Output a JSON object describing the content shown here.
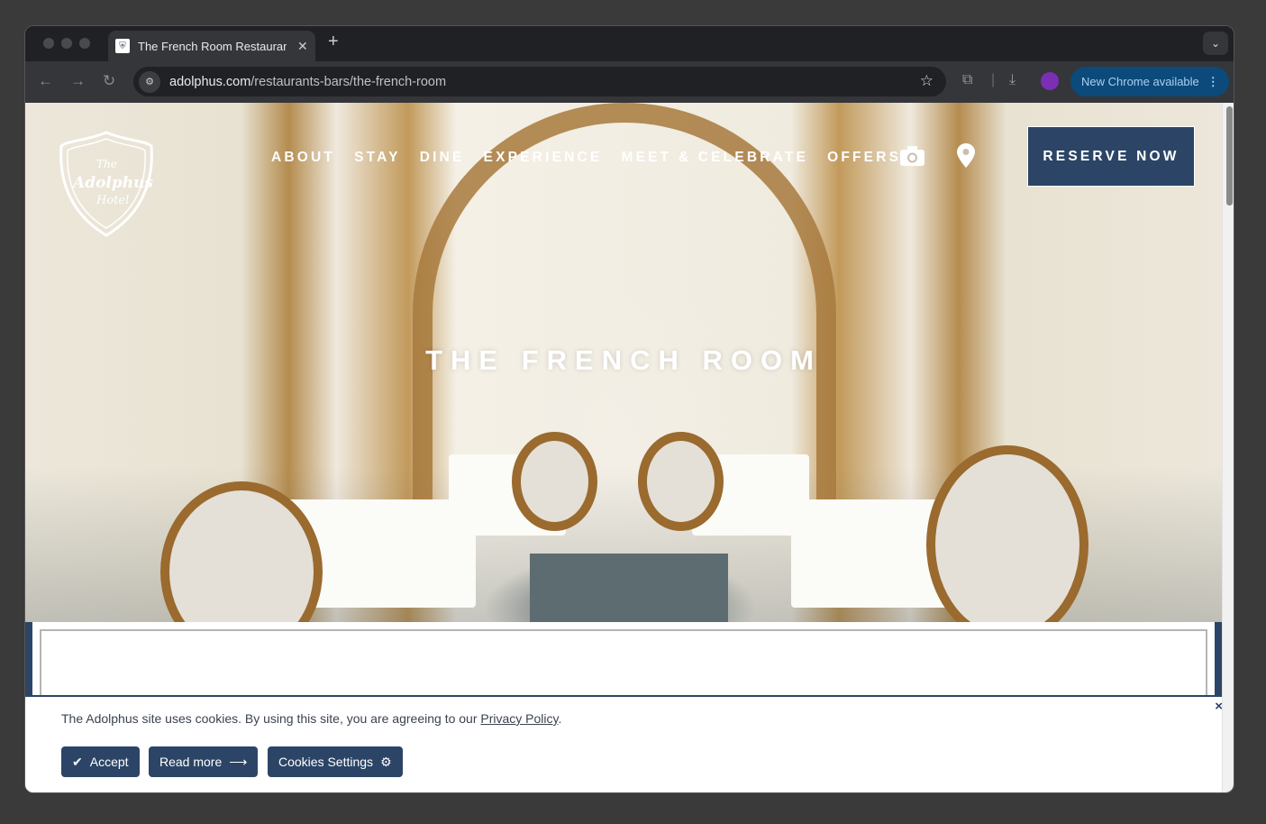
{
  "browser": {
    "tab_title": "The French Room Restaurant",
    "url_domain": "adolphus.com",
    "url_path": "/restaurants-bars/the-french-room",
    "update_label": "New Chrome available"
  },
  "site": {
    "logo_text": "The Adolphus Hotel",
    "menu": [
      "ABOUT",
      "STAY",
      "DINE",
      "EXPERIENCE",
      "MEET & CELEBRATE",
      "OFFERS"
    ],
    "reserve_label": "RESERVE NOW",
    "hero_title": "THE FRENCH ROOM",
    "brand_color": "#2c4566"
  },
  "cookie": {
    "text": "The Adolphus site uses cookies. By using this site, you are agreeing to our ",
    "link": "Privacy Policy",
    "period": ".",
    "accept": "Accept",
    "read_more": "Read more",
    "settings": "Cookies Settings",
    "close": "×"
  }
}
